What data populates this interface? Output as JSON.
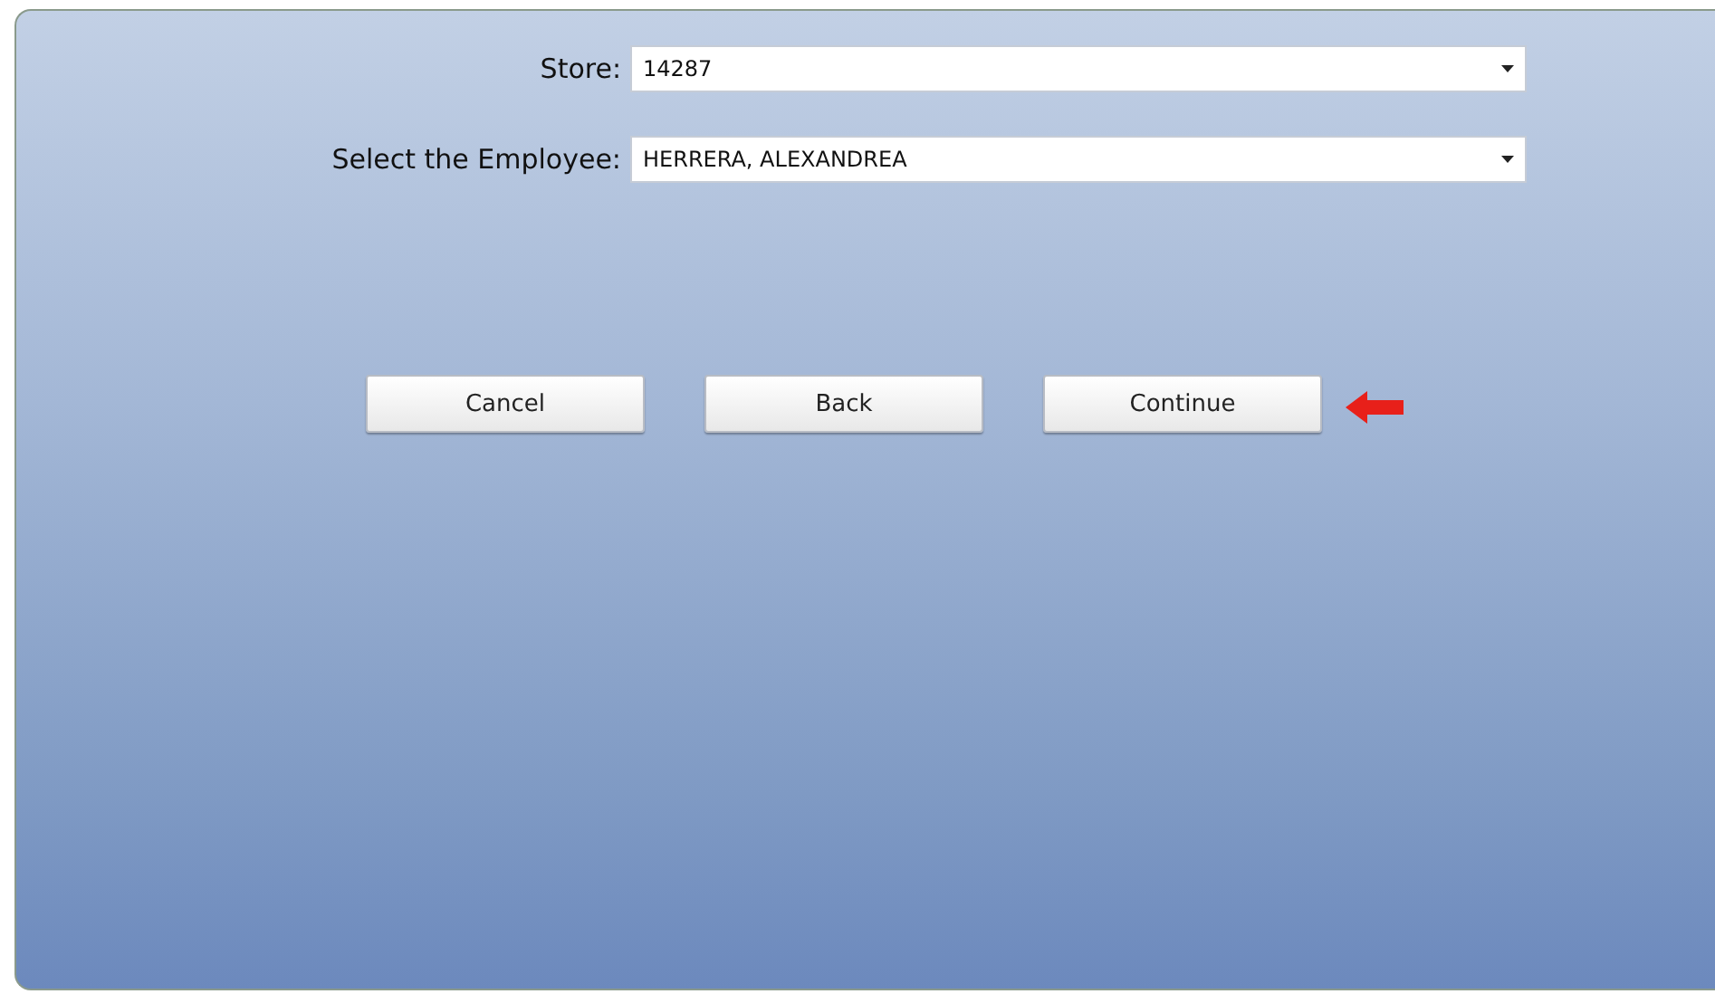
{
  "fields": [
    {
      "label": "Store:",
      "value": "14287"
    },
    {
      "label": "Select the Employee:",
      "value": "HERRERA, ALEXANDREA"
    }
  ],
  "buttons": [
    {
      "label": "Cancel",
      "highlighted": false
    },
    {
      "label": "Back",
      "highlighted": false
    },
    {
      "label": "Continue",
      "highlighted": true
    }
  ]
}
